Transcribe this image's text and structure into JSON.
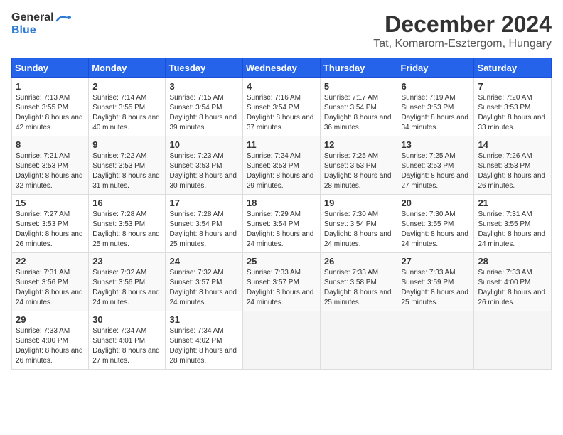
{
  "header": {
    "logo_general": "General",
    "logo_blue": "Blue",
    "title": "December 2024",
    "subtitle": "Tat, Komarom-Esztergom, Hungary"
  },
  "weekdays": [
    "Sunday",
    "Monday",
    "Tuesday",
    "Wednesday",
    "Thursday",
    "Friday",
    "Saturday"
  ],
  "weeks": [
    [
      {
        "day": "1",
        "sunrise": "7:13 AM",
        "sunset": "3:55 PM",
        "daylight": "8 hours and 42 minutes."
      },
      {
        "day": "2",
        "sunrise": "7:14 AM",
        "sunset": "3:55 PM",
        "daylight": "8 hours and 40 minutes."
      },
      {
        "day": "3",
        "sunrise": "7:15 AM",
        "sunset": "3:54 PM",
        "daylight": "8 hours and 39 minutes."
      },
      {
        "day": "4",
        "sunrise": "7:16 AM",
        "sunset": "3:54 PM",
        "daylight": "8 hours and 37 minutes."
      },
      {
        "day": "5",
        "sunrise": "7:17 AM",
        "sunset": "3:54 PM",
        "daylight": "8 hours and 36 minutes."
      },
      {
        "day": "6",
        "sunrise": "7:19 AM",
        "sunset": "3:53 PM",
        "daylight": "8 hours and 34 minutes."
      },
      {
        "day": "7",
        "sunrise": "7:20 AM",
        "sunset": "3:53 PM",
        "daylight": "8 hours and 33 minutes."
      }
    ],
    [
      {
        "day": "8",
        "sunrise": "7:21 AM",
        "sunset": "3:53 PM",
        "daylight": "8 hours and 32 minutes."
      },
      {
        "day": "9",
        "sunrise": "7:22 AM",
        "sunset": "3:53 PM",
        "daylight": "8 hours and 31 minutes."
      },
      {
        "day": "10",
        "sunrise": "7:23 AM",
        "sunset": "3:53 PM",
        "daylight": "8 hours and 30 minutes."
      },
      {
        "day": "11",
        "sunrise": "7:24 AM",
        "sunset": "3:53 PM",
        "daylight": "8 hours and 29 minutes."
      },
      {
        "day": "12",
        "sunrise": "7:25 AM",
        "sunset": "3:53 PM",
        "daylight": "8 hours and 28 minutes."
      },
      {
        "day": "13",
        "sunrise": "7:25 AM",
        "sunset": "3:53 PM",
        "daylight": "8 hours and 27 minutes."
      },
      {
        "day": "14",
        "sunrise": "7:26 AM",
        "sunset": "3:53 PM",
        "daylight": "8 hours and 26 minutes."
      }
    ],
    [
      {
        "day": "15",
        "sunrise": "7:27 AM",
        "sunset": "3:53 PM",
        "daylight": "8 hours and 26 minutes."
      },
      {
        "day": "16",
        "sunrise": "7:28 AM",
        "sunset": "3:53 PM",
        "daylight": "8 hours and 25 minutes."
      },
      {
        "day": "17",
        "sunrise": "7:28 AM",
        "sunset": "3:54 PM",
        "daylight": "8 hours and 25 minutes."
      },
      {
        "day": "18",
        "sunrise": "7:29 AM",
        "sunset": "3:54 PM",
        "daylight": "8 hours and 24 minutes."
      },
      {
        "day": "19",
        "sunrise": "7:30 AM",
        "sunset": "3:54 PM",
        "daylight": "8 hours and 24 minutes."
      },
      {
        "day": "20",
        "sunrise": "7:30 AM",
        "sunset": "3:55 PM",
        "daylight": "8 hours and 24 minutes."
      },
      {
        "day": "21",
        "sunrise": "7:31 AM",
        "sunset": "3:55 PM",
        "daylight": "8 hours and 24 minutes."
      }
    ],
    [
      {
        "day": "22",
        "sunrise": "7:31 AM",
        "sunset": "3:56 PM",
        "daylight": "8 hours and 24 minutes."
      },
      {
        "day": "23",
        "sunrise": "7:32 AM",
        "sunset": "3:56 PM",
        "daylight": "8 hours and 24 minutes."
      },
      {
        "day": "24",
        "sunrise": "7:32 AM",
        "sunset": "3:57 PM",
        "daylight": "8 hours and 24 minutes."
      },
      {
        "day": "25",
        "sunrise": "7:33 AM",
        "sunset": "3:57 PM",
        "daylight": "8 hours and 24 minutes."
      },
      {
        "day": "26",
        "sunrise": "7:33 AM",
        "sunset": "3:58 PM",
        "daylight": "8 hours and 25 minutes."
      },
      {
        "day": "27",
        "sunrise": "7:33 AM",
        "sunset": "3:59 PM",
        "daylight": "8 hours and 25 minutes."
      },
      {
        "day": "28",
        "sunrise": "7:33 AM",
        "sunset": "4:00 PM",
        "daylight": "8 hours and 26 minutes."
      }
    ],
    [
      {
        "day": "29",
        "sunrise": "7:33 AM",
        "sunset": "4:00 PM",
        "daylight": "8 hours and 26 minutes."
      },
      {
        "day": "30",
        "sunrise": "7:34 AM",
        "sunset": "4:01 PM",
        "daylight": "8 hours and 27 minutes."
      },
      {
        "day": "31",
        "sunrise": "7:34 AM",
        "sunset": "4:02 PM",
        "daylight": "8 hours and 28 minutes."
      },
      null,
      null,
      null,
      null
    ]
  ]
}
